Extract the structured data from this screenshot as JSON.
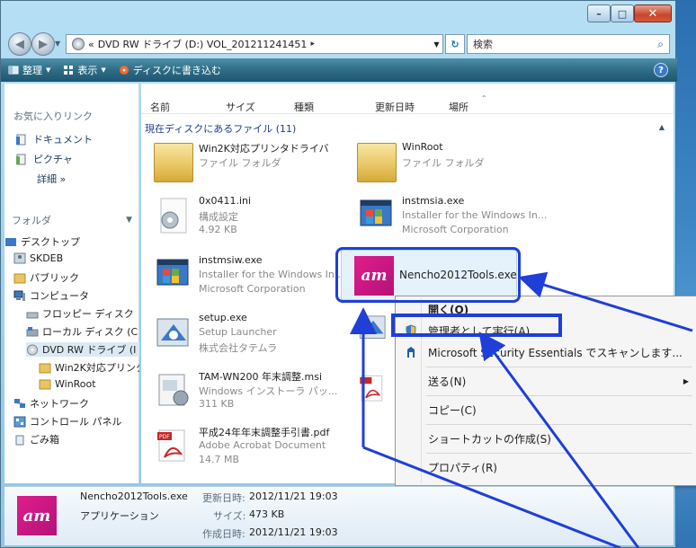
{
  "window": {
    "minimize": "–",
    "maximize": "□",
    "close": "✕"
  },
  "address": {
    "chevrons": "«",
    "drive": "DVD RW ドライブ (D:) VOL_201211241451",
    "sep": "▸",
    "search_placeholder": "検索"
  },
  "toolbar": {
    "organize": "整理",
    "views": "表示",
    "burn": "ディスクに書き込む",
    "help": "?"
  },
  "nav": {
    "favorites_header": "お気に入りリンク",
    "favorites": [
      "ドキュメント",
      "ピクチャ"
    ],
    "more": "詳細  »",
    "folders_header": "フォルダ",
    "tree": [
      "デスクトップ",
      "SKDEB",
      "パブリック",
      "コンピュータ",
      "フロッピー ディスク",
      "ローカル ディスク (C",
      "DVD RW ドライブ (I",
      "Win2K対応プリンタ",
      "WinRoot",
      "ネットワーク",
      "コントロール パネル",
      "ごみ箱"
    ]
  },
  "columns": [
    "名前",
    "サイズ",
    "種類",
    "更新日時",
    "場所"
  ],
  "group_label": "現在ディスクにあるファイル (11)",
  "files": [
    {
      "name": "Win2K対応プリンタドライバ",
      "line2": "ファイル フォルダ",
      "line3": "",
      "icon": "folder-icon"
    },
    {
      "name": "WinRoot",
      "line2": "ファイル フォルダ",
      "line3": "",
      "icon": "folder-icon"
    },
    {
      "name": "0x0411.ini",
      "line2": "構成設定",
      "line3": "4.92 KB",
      "icon": "settings-file-icon"
    },
    {
      "name": "instmsia.exe",
      "line2": "Installer for the Windows In...",
      "line3": "Microsoft Corporation",
      "icon": "installer-icon"
    },
    {
      "name": "instmsiw.exe",
      "line2": "Installer for the Windows In...",
      "line3": "Microsoft Corporation",
      "icon": "installer-icon"
    },
    {
      "name": "Nencho2012Tools.exe",
      "line2": "",
      "line3": "",
      "icon": "tam-logo-icon"
    },
    {
      "name": "setup.exe",
      "line2": "Setup Launcher",
      "line3": "株式会社タテムラ",
      "icon": "setup-icon"
    },
    {
      "name": "TAM-WN200 年末調整.msi",
      "line2": "Windows インストーラ パッ...",
      "line3": "311 KB",
      "icon": "msi-icon"
    },
    {
      "name": "平成24年年末調整手引書.pdf",
      "line2": "Adobe Acrobat Document",
      "line3": "14.7 MB",
      "icon": "pdf-icon"
    }
  ],
  "context_menu": {
    "open": "開く(O)",
    "run_as_admin": "管理者として実行(A)...",
    "scan": "Microsoft Security Essentials でスキャンします...",
    "send_to": "送る(N)",
    "copy": "コピー(C)",
    "create_shortcut": "ショートカットの作成(S)",
    "properties": "プロパティ(R)"
  },
  "details": {
    "name": "Nencho2012Tools.exe",
    "type": "アプリケーション",
    "modified_label": "更新日時:",
    "modified_value": "2012/11/21 19:03",
    "size_label": "サイズ:",
    "size_value": "473 KB",
    "created_label": "作成日時:",
    "created_value": "2012/11/21 19:03"
  },
  "logo_text": "am",
  "colors": {
    "annotation": "#1f3fd8",
    "tam_brand": "#e01d8a",
    "toolbar": "#2f6c86"
  }
}
